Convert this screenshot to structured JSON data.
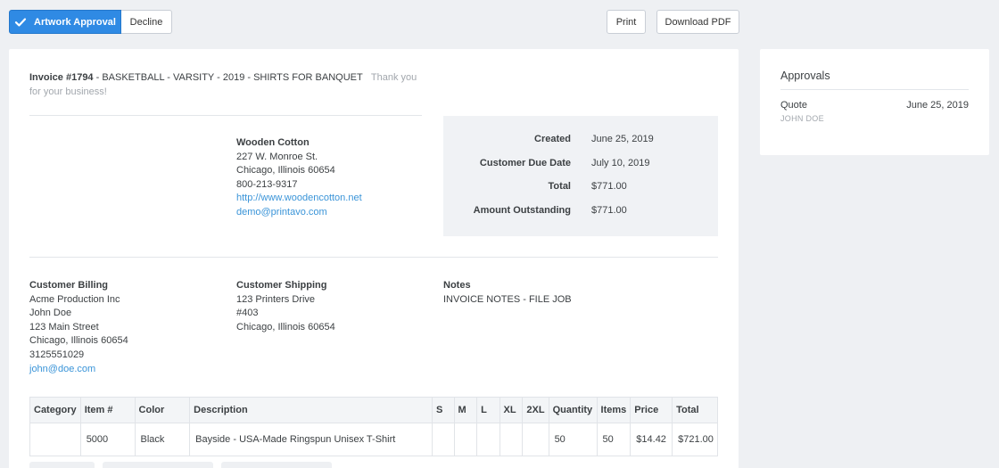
{
  "toolbar": {
    "approve_label": "Artwork Approval",
    "decline_label": "Decline",
    "print_label": "Print",
    "pdf_label": "Download PDF"
  },
  "invoice": {
    "number": "Invoice #1794",
    "title": " - BASKETBALL - VARSITY - 2019 - SHIRTS FOR BANQUET",
    "thanks": "Thank you for your business!"
  },
  "company": {
    "name": "Wooden Cotton",
    "street": "227 W. Monroe St.",
    "city": "Chicago, Illinois 60654",
    "phone": "800-213-9317",
    "website": "http://www.woodencotton.net",
    "email": "demo@printavo.com"
  },
  "summary": [
    {
      "label": "Created",
      "value": "June 25, 2019"
    },
    {
      "label": "Customer Due Date",
      "value": "July 10, 2019"
    },
    {
      "label": "Total",
      "value": "$771.00"
    },
    {
      "label": "Amount Outstanding",
      "value": "$771.00"
    }
  ],
  "billing": {
    "heading": "Customer Billing",
    "company": "Acme Production Inc",
    "contact": "John Doe",
    "street": "123 Main Street",
    "city": "Chicago, Illinois 60654",
    "phone": "3125551029",
    "email": "john@doe.com"
  },
  "shipping": {
    "heading": "Customer Shipping",
    "street": "123 Printers Drive",
    "unit": "#403",
    "city": "Chicago, Illinois 60654"
  },
  "notes": {
    "heading": "Notes",
    "text": "INVOICE NOTES - FILE JOB"
  },
  "table": {
    "headers": [
      "Category",
      "Item #",
      "Color",
      "Description",
      "S",
      "M",
      "L",
      "XL",
      "2XL",
      "Quantity",
      "Items",
      "Price",
      "Total"
    ],
    "rows": [
      [
        "",
        "5000",
        "Black",
        "Bayside - USA-Made Ringspun Unisex T-Shirt",
        "",
        "",
        "",
        "",
        "",
        "50",
        "50",
        "$14.42",
        "$721.00"
      ]
    ]
  },
  "approvals": {
    "title": "Approvals",
    "type": "Quote",
    "date": "June 25, 2019",
    "user": "JOHN DOE"
  },
  "colors": {
    "primary": "#2f8ae4",
    "link": "#3a94d8",
    "muted": "#a2a7ad",
    "background": "#eef0f3"
  }
}
